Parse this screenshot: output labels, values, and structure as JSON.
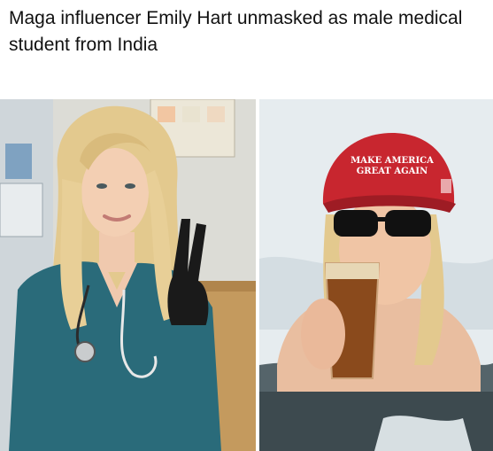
{
  "headline": {
    "text": "Maga influencer Emily Hart unmasked as male medical student from India"
  },
  "photos": {
    "left": {
      "kind": "photo",
      "subject": "woman-in-teal-scrubs-peace-sign"
    },
    "right": {
      "kind": "photo",
      "subject": "woman-in-red-cap-drinking-beer-in-ice-water",
      "hat_text_line1": "MAKE AMERICA",
      "hat_text_line2": "GREAT AGAIN"
    }
  },
  "colors": {
    "scrubs": "#2a6b7a",
    "hat": "#c8262f",
    "beer": "#8a4a1c",
    "hair": "#e3c98e"
  }
}
